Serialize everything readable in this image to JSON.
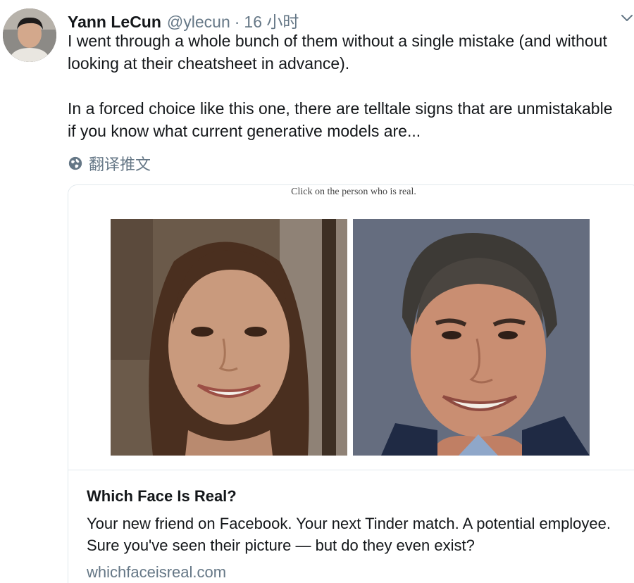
{
  "tweet": {
    "author_name": "Yann LeCun",
    "handle": "@ylecun",
    "separator": "·",
    "time": "16 小时",
    "paragraphs": [
      "I went through a whole bunch of them without a single mistake (and without looking at their cheatsheet in advance).",
      "In a forced choice like this one, there are telltale signs that are unmistakable if you know what current generative models are..."
    ],
    "translate_label": "翻译推文",
    "icons": {
      "caret": "chevron-down-icon",
      "translate": "globe-icon"
    }
  },
  "card": {
    "media_caption": "Click on the person who is real.",
    "title": "Which Face Is Real?",
    "description": "Your new friend on Facebook. Your next Tinder match. A potential employee. Sure you've seen their picture — but do they even exist?",
    "domain": "whichfaceisreal.com"
  },
  "colors": {
    "text_primary": "#14171a",
    "text_secondary": "#657786",
    "border": "#e1e8ed"
  }
}
